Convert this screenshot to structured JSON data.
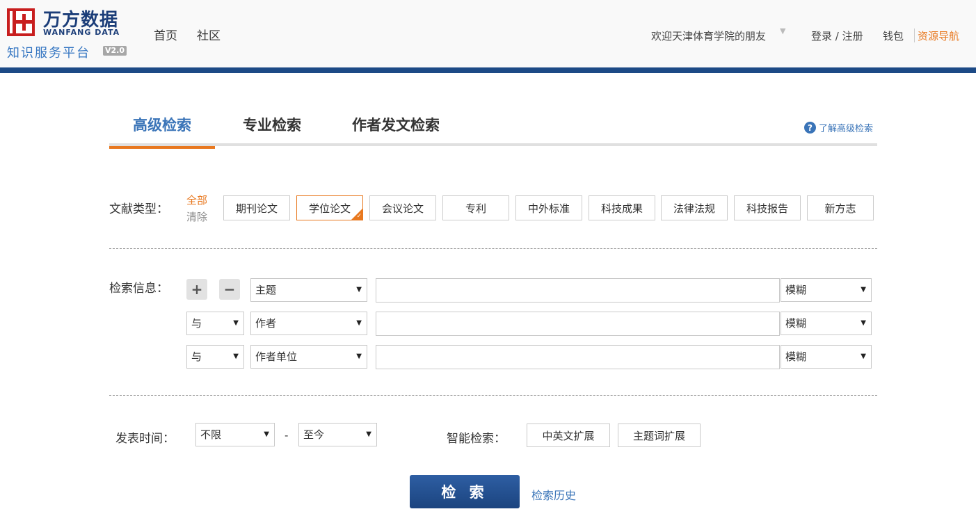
{
  "header": {
    "logo": {
      "name_cn": "万方数据",
      "name_en": "WANFANG DATA",
      "subtitle": "知识服务平台",
      "version": "V2.0",
      "brand_color": "#c81e1e"
    },
    "nav": [
      {
        "label": "首页"
      },
      {
        "label": "社区"
      }
    ],
    "welcome": "欢迎天津体育学院的朋友",
    "login_register": "登录 / 注册",
    "wallet": "钱包",
    "resource_nav": "资源导航",
    "accent_color": "#e8781f",
    "bar_color": "#1d4a86"
  },
  "tabs": [
    {
      "label": "高级检索",
      "active": true
    },
    {
      "label": "专业检索",
      "active": false
    },
    {
      "label": "作者发文检索",
      "active": false
    }
  ],
  "help_link": "了解高级检索",
  "doc_type": {
    "label": "文献类型：",
    "all": "全部",
    "clear": "清除",
    "types": [
      {
        "label": "期刊论文",
        "selected": false
      },
      {
        "label": "学位论文",
        "selected": true
      },
      {
        "label": "会议论文",
        "selected": false
      },
      {
        "label": "专利",
        "selected": false
      },
      {
        "label": "中外标准",
        "selected": false
      },
      {
        "label": "科技成果",
        "selected": false
      },
      {
        "label": "法律法规",
        "selected": false
      },
      {
        "label": "科技报告",
        "selected": false
      },
      {
        "label": "新方志",
        "selected": false
      }
    ]
  },
  "search_info": {
    "label": "检索信息：",
    "add": "+",
    "remove": "−",
    "rows": [
      {
        "logic": "",
        "field": "主题",
        "value": "",
        "match": "模糊"
      },
      {
        "logic": "与",
        "field": "作者",
        "value": "",
        "match": "模糊"
      },
      {
        "logic": "与",
        "field": "作者单位",
        "value": "",
        "match": "模糊"
      }
    ]
  },
  "publish_time": {
    "label": "发表时间：",
    "from": "不限",
    "separator": "-",
    "to": "至今"
  },
  "smart_search": {
    "label": "智能检索：",
    "options": [
      "中英文扩展",
      "主题词扩展"
    ]
  },
  "search_button": "检 索",
  "history_link": "检索历史"
}
